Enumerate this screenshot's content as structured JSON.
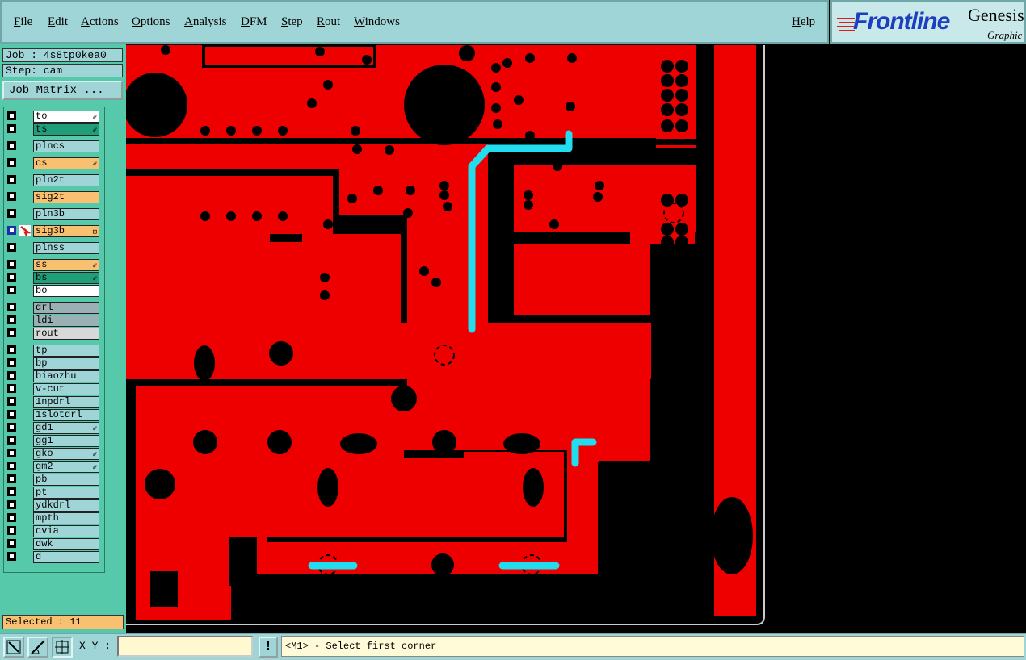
{
  "menubar": {
    "items": [
      "File",
      "Edit",
      "Actions",
      "Options",
      "Analysis",
      "DFM",
      "Step",
      "Rout",
      "Windows"
    ],
    "help": "Help"
  },
  "logo": {
    "brand": "Frontline",
    "product": "Genesis",
    "subtitle": "Graphic"
  },
  "panel": {
    "job": "Job : 4s8tp0kea0",
    "step": "Step: cam",
    "job_matrix": "Job Matrix ...",
    "selected": "Selected : 11"
  },
  "layers": [
    {
      "name": "to",
      "color": "#ffffff",
      "mark": "✐"
    },
    {
      "name": "ts",
      "color": "#1f9e7a",
      "mark": "✐"
    },
    {
      "name": "plncs",
      "color": "#9fd5d7",
      "mark": ""
    },
    {
      "name": "cs",
      "color": "#f8c070",
      "mark": "✐"
    },
    {
      "name": "pln2t",
      "color": "#9fd5d7",
      "mark": ""
    },
    {
      "name": "sig2t",
      "color": "#f8c070",
      "mark": ""
    },
    {
      "name": "pln3b",
      "color": "#9fd5d7",
      "mark": ""
    },
    {
      "name": "sig3b",
      "color": "#f8c070",
      "mark": "⊞",
      "active": true
    },
    {
      "name": "plnss",
      "color": "#9fd5d7",
      "mark": ""
    },
    {
      "name": "ss",
      "color": "#f8c070",
      "mark": "✐"
    },
    {
      "name": "bs",
      "color": "#1f9e7a",
      "mark": "✐"
    },
    {
      "name": "bo",
      "color": "#ffffff",
      "mark": ""
    },
    {
      "name": "drl",
      "color": "#9ab0b4",
      "mark": ""
    },
    {
      "name": "ldi",
      "color": "#9ab0b4",
      "mark": ""
    },
    {
      "name": "rout",
      "color": "#d8d8d8",
      "mark": ""
    },
    {
      "name": "tp",
      "color": "#9fd5d7",
      "mark": ""
    },
    {
      "name": "bp",
      "color": "#9fd5d7",
      "mark": ""
    },
    {
      "name": "biaozhu",
      "color": "#9fd5d7",
      "mark": ""
    },
    {
      "name": "v-cut",
      "color": "#9fd5d7",
      "mark": ""
    },
    {
      "name": "1npdrl",
      "color": "#9fd5d7",
      "mark": ""
    },
    {
      "name": "1slotdrl",
      "color": "#9fd5d7",
      "mark": ""
    },
    {
      "name": "gd1",
      "color": "#9fd5d7",
      "mark": "✐"
    },
    {
      "name": "gg1",
      "color": "#9fd5d7",
      "mark": ""
    },
    {
      "name": "gko",
      "color": "#9fd5d7",
      "mark": "✐"
    },
    {
      "name": "gm2",
      "color": "#9fd5d7",
      "mark": "✐"
    },
    {
      "name": "pb",
      "color": "#9fd5d7",
      "mark": ""
    },
    {
      "name": "pt",
      "color": "#9fd5d7",
      "mark": ""
    },
    {
      "name": "ydkdrl",
      "color": "#9fd5d7",
      "mark": ""
    },
    {
      "name": "mpth",
      "color": "#9fd5d7",
      "mark": ""
    },
    {
      "name": "cvia",
      "color": "#9fd5d7",
      "mark": ""
    },
    {
      "name": "dwk",
      "color": "#9fd5d7",
      "mark": ""
    },
    {
      "name": "d",
      "color": "#9fd5d7",
      "mark": ""
    }
  ],
  "bottombar": {
    "xy_label": "X Y :",
    "xy_value": "",
    "warn": "!",
    "status": "<M1> - Select first corner"
  },
  "colors": {
    "copper": "#ee0000",
    "highlight": "#22ddee",
    "panel_bg": "#56c9aa",
    "menu_bg": "#9fd5d7"
  }
}
